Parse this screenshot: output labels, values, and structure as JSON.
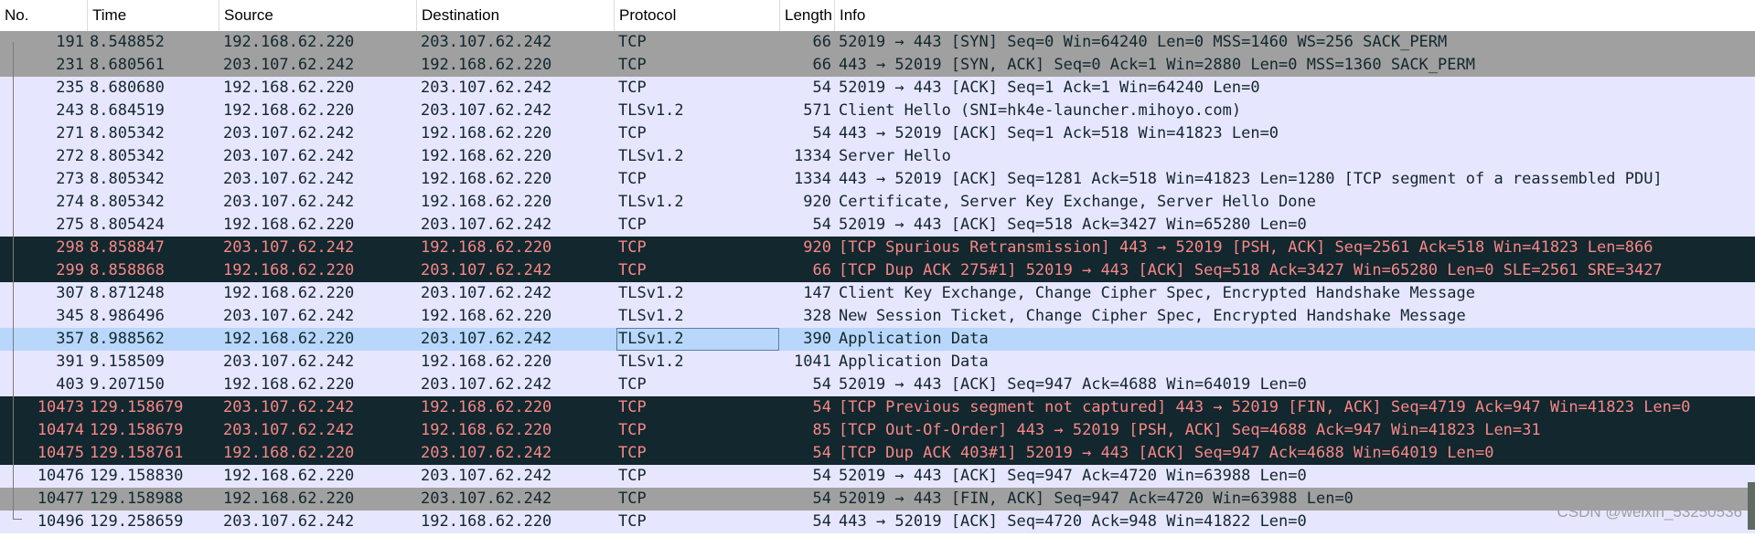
{
  "columns": {
    "no": "No.",
    "time": "Time",
    "source": "Source",
    "destination": "Destination",
    "protocol": "Protocol",
    "length": "Length",
    "info": "Info"
  },
  "row_colors": {
    "tcp": "#e7e6ff",
    "syn_fin": "#a0a0a0",
    "bad_tcp": "#12272e",
    "bad_tcp_text": "#f78787",
    "selected": "#b9d7fb"
  },
  "packets": [
    {
      "no": "191",
      "time": "8.548852",
      "src": "192.168.62.220",
      "dst": "203.107.62.242",
      "proto": "TCP",
      "len": "66",
      "info": "52019 → 443 [SYN] Seq=0 Win=64240 Len=0 MSS=1460 WS=256 SACK_PERM",
      "style": "syn"
    },
    {
      "no": "231",
      "time": "8.680561",
      "src": "203.107.62.242",
      "dst": "192.168.62.220",
      "proto": "TCP",
      "len": "66",
      "info": "443 → 52019 [SYN, ACK] Seq=0 Ack=1 Win=2880 Len=0 MSS=1360 SACK_PERM",
      "style": "syn"
    },
    {
      "no": "235",
      "time": "8.680680",
      "src": "192.168.62.220",
      "dst": "203.107.62.242",
      "proto": "TCP",
      "len": "54",
      "info": "52019 → 443 [ACK] Seq=1 Ack=1 Win=64240 Len=0",
      "style": "tcp"
    },
    {
      "no": "243",
      "time": "8.684519",
      "src": "192.168.62.220",
      "dst": "203.107.62.242",
      "proto": "TLSv1.2",
      "len": "571",
      "info": "Client Hello (SNI=hk4e-launcher.mihoyo.com)",
      "style": "tcp"
    },
    {
      "no": "271",
      "time": "8.805342",
      "src": "203.107.62.242",
      "dst": "192.168.62.220",
      "proto": "TCP",
      "len": "54",
      "info": "443 → 52019 [ACK] Seq=1 Ack=518 Win=41823 Len=0",
      "style": "tcp"
    },
    {
      "no": "272",
      "time": "8.805342",
      "src": "203.107.62.242",
      "dst": "192.168.62.220",
      "proto": "TLSv1.2",
      "len": "1334",
      "info": "Server Hello",
      "style": "tcp"
    },
    {
      "no": "273",
      "time": "8.805342",
      "src": "203.107.62.242",
      "dst": "192.168.62.220",
      "proto": "TCP",
      "len": "1334",
      "info": "443 → 52019 [ACK] Seq=1281 Ack=518 Win=41823 Len=1280 [TCP segment of a reassembled PDU]",
      "style": "tcp"
    },
    {
      "no": "274",
      "time": "8.805342",
      "src": "203.107.62.242",
      "dst": "192.168.62.220",
      "proto": "TLSv1.2",
      "len": "920",
      "info": "Certificate, Server Key Exchange, Server Hello Done",
      "style": "tcp"
    },
    {
      "no": "275",
      "time": "8.805424",
      "src": "192.168.62.220",
      "dst": "203.107.62.242",
      "proto": "TCP",
      "len": "54",
      "info": "52019 → 443 [ACK] Seq=518 Ack=3427 Win=65280 Len=0",
      "style": "tcp"
    },
    {
      "no": "298",
      "time": "8.858847",
      "src": "203.107.62.242",
      "dst": "192.168.62.220",
      "proto": "TCP",
      "len": "920",
      "info": "[TCP Spurious Retransmission] 443 → 52019 [PSH, ACK] Seq=2561 Ack=518 Win=41823 Len=866",
      "style": "bad"
    },
    {
      "no": "299",
      "time": "8.858868",
      "src": "192.168.62.220",
      "dst": "203.107.62.242",
      "proto": "TCP",
      "len": "66",
      "info": "[TCP Dup ACK 275#1] 52019 → 443 [ACK] Seq=518 Ack=3427 Win=65280 Len=0 SLE=2561 SRE=3427",
      "style": "bad"
    },
    {
      "no": "307",
      "time": "8.871248",
      "src": "192.168.62.220",
      "dst": "203.107.62.242",
      "proto": "TLSv1.2",
      "len": "147",
      "info": "Client Key Exchange, Change Cipher Spec, Encrypted Handshake Message",
      "style": "tcp"
    },
    {
      "no": "345",
      "time": "8.986496",
      "src": "203.107.62.242",
      "dst": "192.168.62.220",
      "proto": "TLSv1.2",
      "len": "328",
      "info": "New Session Ticket, Change Cipher Spec, Encrypted Handshake Message",
      "style": "tcp"
    },
    {
      "no": "357",
      "time": "8.988562",
      "src": "192.168.62.220",
      "dst": "203.107.62.242",
      "proto": "TLSv1.2",
      "len": "390",
      "info": "Application Data",
      "style": "sel"
    },
    {
      "no": "391",
      "time": "9.158509",
      "src": "203.107.62.242",
      "dst": "192.168.62.220",
      "proto": "TLSv1.2",
      "len": "1041",
      "info": "Application Data",
      "style": "tcp"
    },
    {
      "no": "403",
      "time": "9.207150",
      "src": "192.168.62.220",
      "dst": "203.107.62.242",
      "proto": "TCP",
      "len": "54",
      "info": "52019 → 443 [ACK] Seq=947 Ack=4688 Win=64019 Len=0",
      "style": "tcp"
    },
    {
      "no": "10473",
      "time": "129.158679",
      "src": "203.107.62.242",
      "dst": "192.168.62.220",
      "proto": "TCP",
      "len": "54",
      "info": "[TCP Previous segment not captured] 443 → 52019 [FIN, ACK] Seq=4719 Ack=947 Win=41823 Len=0",
      "style": "bad"
    },
    {
      "no": "10474",
      "time": "129.158679",
      "src": "203.107.62.242",
      "dst": "192.168.62.220",
      "proto": "TCP",
      "len": "85",
      "info": "[TCP Out-Of-Order] 443 → 52019 [PSH, ACK] Seq=4688 Ack=947 Win=41823 Len=31",
      "style": "bad"
    },
    {
      "no": "10475",
      "time": "129.158761",
      "src": "192.168.62.220",
      "dst": "203.107.62.242",
      "proto": "TCP",
      "len": "54",
      "info": "[TCP Dup ACK 403#1] 52019 → 443 [ACK] Seq=947 Ack=4688 Win=64019 Len=0",
      "style": "bad"
    },
    {
      "no": "10476",
      "time": "129.158830",
      "src": "192.168.62.220",
      "dst": "203.107.62.242",
      "proto": "TCP",
      "len": "54",
      "info": "52019 → 443 [ACK] Seq=947 Ack=4720 Win=63988 Len=0",
      "style": "tcp"
    },
    {
      "no": "10477",
      "time": "129.158988",
      "src": "192.168.62.220",
      "dst": "203.107.62.242",
      "proto": "TCP",
      "len": "54",
      "info": "52019 → 443 [FIN, ACK] Seq=947 Ack=4720 Win=63988 Len=0",
      "style": "syn"
    },
    {
      "no": "10496",
      "time": "129.258659",
      "src": "203.107.62.242",
      "dst": "192.168.62.220",
      "proto": "TCP",
      "len": "54",
      "info": "443 → 52019 [ACK] Seq=4720 Ack=948 Win=41822 Len=0",
      "style": "tcp"
    }
  ],
  "watermark": "CSDN @weixin_53250536"
}
